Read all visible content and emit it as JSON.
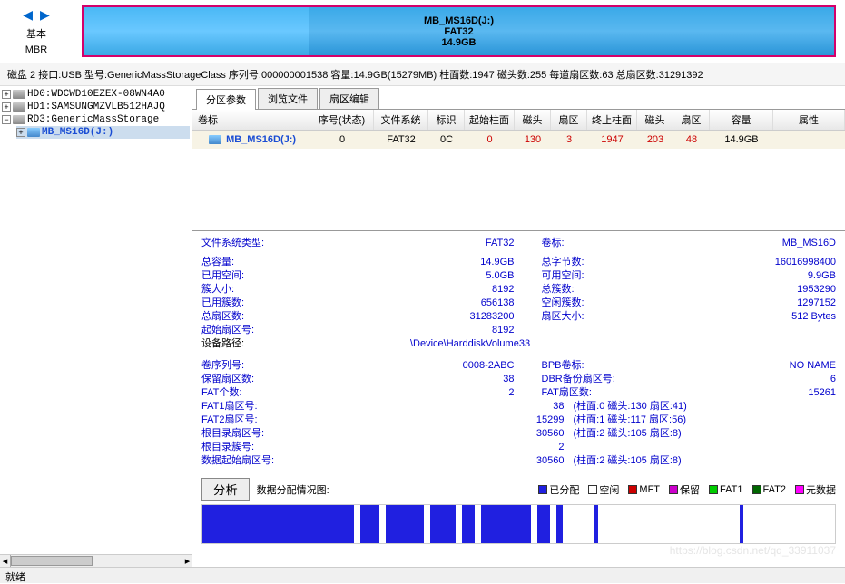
{
  "top": {
    "basic": "基本",
    "mbr": "MBR",
    "part_name": "MB_MS16D(J:)",
    "part_fs": "FAT32",
    "part_size": "14.9GB"
  },
  "info_line": "磁盘 2 接口:USB 型号:GenericMassStorageClass 序列号:000000001538 容量:14.9GB(15279MB) 柱面数:1947 磁头数:255 每道扇区数:63 总扇区数:31291392",
  "tree": {
    "hd0": "HD0:WDCWD10EZEX-08WN4A0",
    "hd1": "HD1:SAMSUNGMZVLB512HAJQ",
    "rd3": "RD3:GenericMassStorage",
    "rd3_part": "MB_MS16D(J:)"
  },
  "tabs": {
    "t1": "分区参数",
    "t2": "浏览文件",
    "t3": "扇区编辑"
  },
  "headers": {
    "label": "卷标",
    "seq": "序号(状态)",
    "fs": "文件系统",
    "flag": "标识",
    "start_cyl": "起始柱面",
    "head": "磁头",
    "sector": "扇区",
    "end_cyl": "终止柱面",
    "head2": "磁头",
    "sector2": "扇区",
    "capacity": "容量",
    "attr": "属性"
  },
  "row": {
    "name": "MB_MS16D(J:)",
    "seq": "0",
    "fs": "FAT32",
    "flag": "0C",
    "start_cyl": "0",
    "head": "130",
    "sector": "3",
    "end_cyl": "1947",
    "head2": "203",
    "sector2": "48",
    "capacity": "14.9GB"
  },
  "details": {
    "fs_type_label": "文件系统类型:",
    "fs_type": "FAT32",
    "vol_label_label": "卷标:",
    "vol_label": "MB_MS16D",
    "total_cap_label": "总容量:",
    "total_cap": "14.9GB",
    "total_bytes_label": "总字节数:",
    "total_bytes": "16016998400",
    "used_label": "已用空间:",
    "used": "5.0GB",
    "avail_label": "可用空间:",
    "avail": "9.9GB",
    "cluster_size_label": "簇大小:",
    "cluster_size": "8192",
    "total_clusters_label": "总簇数:",
    "total_clusters": "1953290",
    "used_clusters_label": "已用簇数:",
    "used_clusters": "656138",
    "free_clusters_label": "空闲簇数:",
    "free_clusters": "1297152",
    "total_sectors_label": "总扇区数:",
    "total_sectors": "31283200",
    "sector_size_label": "扇区大小:",
    "sector_size": "512 Bytes",
    "start_sector_label": "起始扇区号:",
    "start_sector": "8192",
    "device_path_label": "设备路径:",
    "device_path": "\\Device\\HarddiskVolume33",
    "vol_serial_label": "卷序列号:",
    "vol_serial": "0008-2ABC",
    "bpb_label": "BPB卷标:",
    "bpb": "NO NAME",
    "reserved_label": "保留扇区数:",
    "reserved": "38",
    "dbr_backup_label": "DBR备份扇区号:",
    "dbr_backup": "6",
    "fat_count_label": "FAT个数:",
    "fat_count": "2",
    "fat_sectors_label": "FAT扇区数:",
    "fat_sectors": "15261",
    "fat1_sector_label": "FAT1扇区号:",
    "fat1_sector": "38",
    "fat1_chs": "(柱面:0 磁头:130 扇区:41)",
    "fat2_sector_label": "FAT2扇区号:",
    "fat2_sector": "15299",
    "fat2_chs": "(柱面:1 磁头:117 扇区:56)",
    "root_sector_label": "根目录扇区号:",
    "root_sector": "30560",
    "root_chs": "(柱面:2 磁头:105 扇区:8)",
    "root_cluster_label": "根目录簇号:",
    "root_cluster": "2",
    "data_start_label": "数据起始扇区号:",
    "data_start": "30560",
    "data_chs": "(柱面:2 磁头:105 扇区:8)"
  },
  "analyze": {
    "btn": "分析",
    "map_label": "数据分配情况图:",
    "legend": {
      "allocated": "已分配",
      "free": "空闲",
      "mft": "MFT",
      "reserved": "保留",
      "fat1": "FAT1",
      "fat2": "FAT2",
      "meta": "元数据"
    }
  },
  "status": "就绪",
  "watermark": "https://blog.csdn.net/qq_33911037"
}
